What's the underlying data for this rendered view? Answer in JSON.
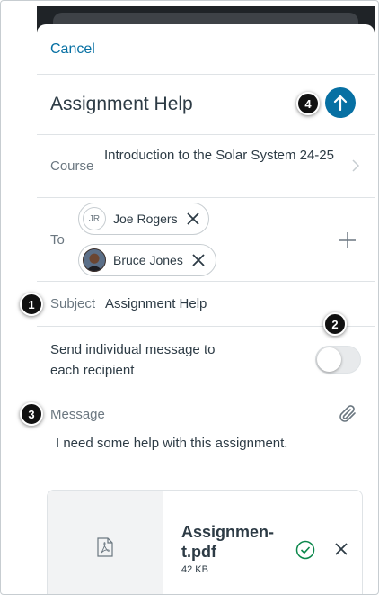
{
  "header": {
    "cancel_label": "Cancel",
    "title": "Assignment Help"
  },
  "course": {
    "label": "Course",
    "value": "Introduction to the Solar System 24-25"
  },
  "recipients": {
    "label": "To",
    "chips": [
      {
        "initials": "JR",
        "name": "Joe Rogers"
      },
      {
        "initials": "",
        "name": "Bruce Jones"
      }
    ]
  },
  "subject": {
    "label": "Subject",
    "value": "Assignment Help"
  },
  "individual": {
    "label": "Send individual message to each recipient",
    "enabled": false
  },
  "message": {
    "label": "Message",
    "body": "I need some help with this assignment."
  },
  "attachment": {
    "file_name": "Assignmen-t.pdf",
    "file_size": "42 KB"
  },
  "callouts": [
    "1",
    "2",
    "3",
    "4"
  ],
  "colors": {
    "accent": "#0770a3",
    "text": "#2d3b45",
    "muted": "#6b7780",
    "success": "#0b874b"
  },
  "icons": [
    "send-arrow-up-icon",
    "chevron-right-icon",
    "close-icon",
    "plus-icon",
    "paperclip-icon",
    "pdf-file-icon",
    "check-circle-icon"
  ]
}
